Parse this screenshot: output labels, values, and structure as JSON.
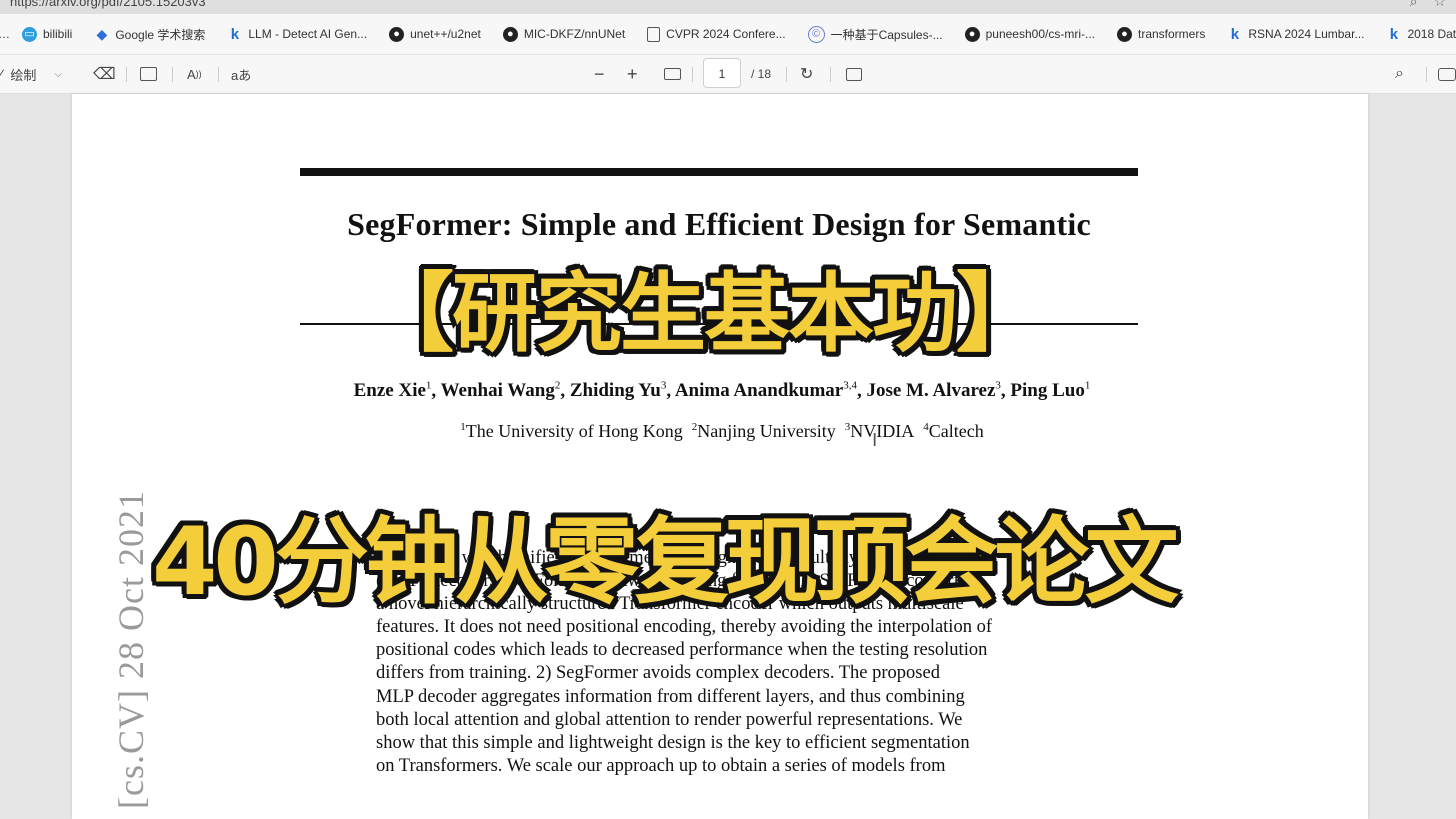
{
  "browser": {
    "url": "https://arxiv.org/pdf/2105.15203v3",
    "bookmarks": [
      {
        "icon": "bilibili-icon",
        "label": "bilibili"
      },
      {
        "icon": "google-icon",
        "label": "Google 学术搜索"
      },
      {
        "icon": "kaggle-icon",
        "label": "LLM - Detect AI Gen..."
      },
      {
        "icon": "github-icon",
        "label": "unet++/u2net"
      },
      {
        "icon": "github-icon",
        "label": "MIC-DKFZ/nnUNet"
      },
      {
        "icon": "document-icon",
        "label": "CVPR 2024 Confere..."
      },
      {
        "icon": "cnki-icon",
        "label": "一种基于Capsules-..."
      },
      {
        "icon": "github-icon",
        "label": "puneesh00/cs-mri-..."
      },
      {
        "icon": "github-icon",
        "label": "transformers"
      },
      {
        "icon": "kaggle-icon",
        "label": "RSNA 2024 Lumbar..."
      },
      {
        "icon": "kaggle-icon",
        "label": "2018 Data"
      }
    ]
  },
  "pdf_toolbar": {
    "draw_label": "绘制",
    "read_aloud_label": "A",
    "translate_label": "aあ",
    "current_page": "1",
    "total_pages": "/ 18"
  },
  "paper": {
    "title": "SegFormer: Simple and Efficient Design for Semantic",
    "authors": [
      {
        "name": "Enze Xie",
        "sup": "1"
      },
      {
        "name": "Wenhai Wang",
        "sup": "2"
      },
      {
        "name": "Zhiding Yu",
        "sup": "3"
      },
      {
        "name": "Anima Anandkumar",
        "sup": "3,4"
      },
      {
        "name": "Jose M. Alvarez",
        "sup": "3"
      },
      {
        "name": "Ping Luo",
        "sup": "1"
      }
    ],
    "affiliations": [
      {
        "sup": "1",
        "name": "The University of Hong Kong"
      },
      {
        "sup": "2",
        "name": "Nanjing University"
      },
      {
        "sup": "3",
        "name": "NVIDIA"
      },
      {
        "sup": "4",
        "name": "Caltech"
      }
    ],
    "arxiv_stamp": "[cs.CV]  28 Oct 2021",
    "abstract_lines": [
      "framework which unifies Transformers with lightweight multilayer perceptron",
      "(MLP) decoders. SegFormer has two appealing features: 1) SegFormer comprises",
      "a novel hierarchically structured Transformer encoder which outputs multiscale",
      "features. It does not need positional encoding, thereby avoiding the interpolation of",
      "positional codes which leads to decreased performance when the testing resolution",
      "differs from training.  2) SegFormer avoids complex decoders.  The proposed",
      "MLP decoder aggregates information from different layers, and thus combining",
      "both local attention and global attention to render powerful representations. We",
      "show that this simple and lightweight design is the key to efficient segmentation",
      "on Transformers.  We scale our approach up to obtain a series of models from"
    ]
  },
  "overlay": {
    "line1": "【研究生基本功】",
    "line2": "40分钟从零复现顶会论文"
  },
  "colors": {
    "overlay_fill": "#f4cd3a",
    "overlay_stroke": "#111111"
  }
}
